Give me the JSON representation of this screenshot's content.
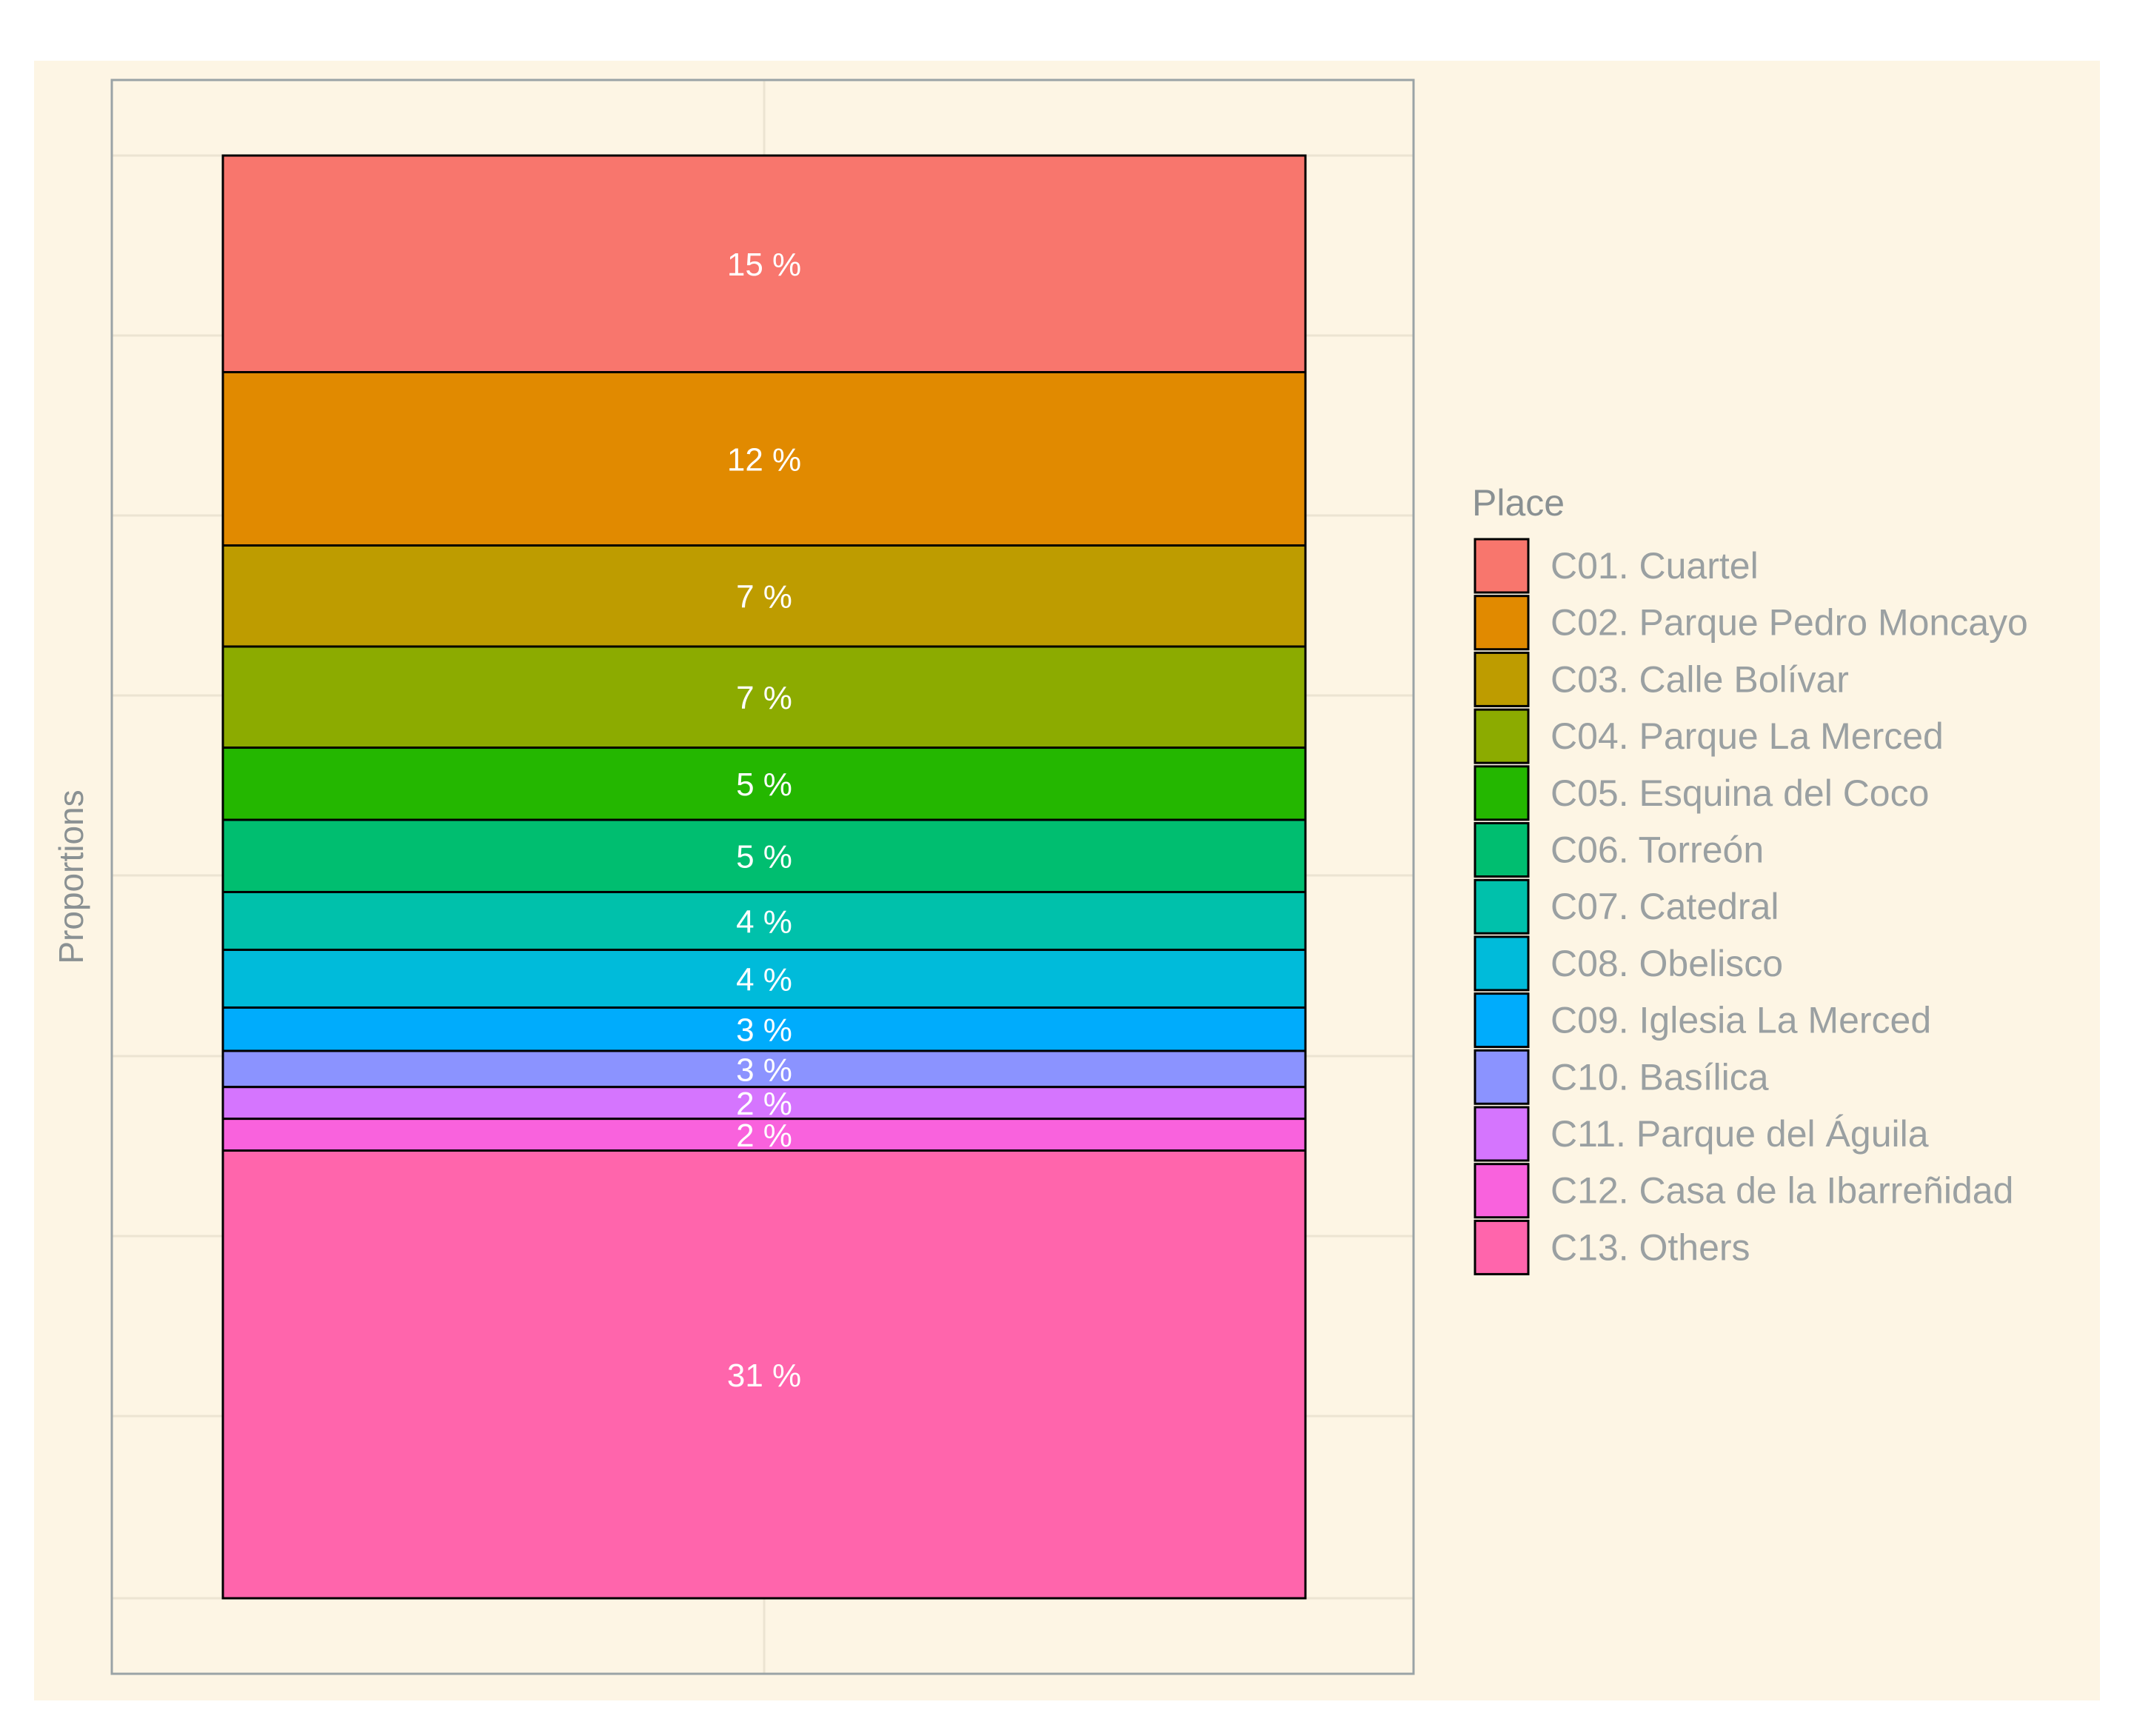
{
  "chart_data": {
    "type": "bar",
    "ylabel": "Proportions",
    "legend": {
      "title": "Place",
      "position": "right"
    },
    "grid": true,
    "stacked": true,
    "background": "#fdf5e4",
    "series": [
      {
        "name": "C01. Cuartel",
        "value": 15,
        "label": "15 %",
        "color": "#f8766d"
      },
      {
        "name": "C02. Parque Pedro Moncayo",
        "value": 12,
        "label": "12 %",
        "color": "#e18a00"
      },
      {
        "name": "C03. Calle Bolívar",
        "value": 7,
        "label": "7 %",
        "color": "#be9c00"
      },
      {
        "name": "C04. Parque La Merced",
        "value": 7,
        "label": "7 %",
        "color": "#8cab00"
      },
      {
        "name": "C05. Esquina del Coco",
        "value": 5,
        "label": "5 %",
        "color": "#24b700"
      },
      {
        "name": "C06. Torreón",
        "value": 5,
        "label": "5 %",
        "color": "#00be70"
      },
      {
        "name": "C07. Catedral",
        "value": 4,
        "label": "4 %",
        "color": "#00c1ab"
      },
      {
        "name": "C08. Obelisco",
        "value": 4,
        "label": "4 %",
        "color": "#00bbda"
      },
      {
        "name": "C09. Iglesia La Merced",
        "value": 3,
        "label": "3 %",
        "color": "#00acfc"
      },
      {
        "name": "C10. Basílica",
        "value": 2.5,
        "label": "3 %",
        "color": "#8b93ff"
      },
      {
        "name": "C11. Parque del Águila",
        "value": 2.2,
        "label": "2 %",
        "color": "#d575fe"
      },
      {
        "name": "C12. Casa de la Ibarreñidad",
        "value": 2.2,
        "label": "2 %",
        "color": "#f962dd"
      },
      {
        "name": "C13. Others",
        "value": 31,
        "label": "31 %",
        "color": "#ff65ac"
      }
    ]
  }
}
